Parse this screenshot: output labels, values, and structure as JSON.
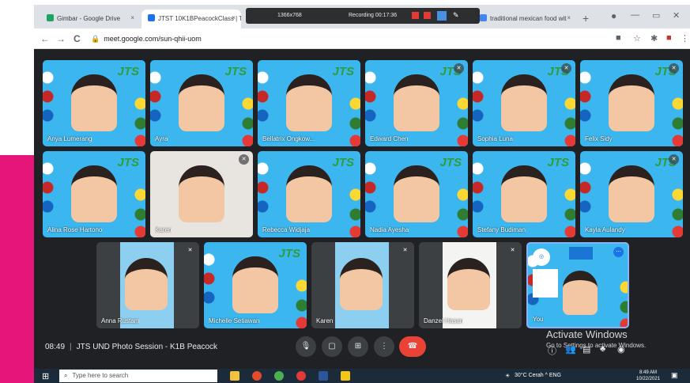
{
  "browser": {
    "tabs": [
      {
        "label": "Gimbar - Google Drive",
        "icon": "drive-icon",
        "color": "#1ea362"
      },
      {
        "label": "JTST 10K1BPeacockClass | To...",
        "icon": "meet-icon",
        "color": "#1a73e8"
      },
      {
        "label": "traditional mexican food wit",
        "icon": "google-icon",
        "color": "#4285f4"
      }
    ],
    "close_glyph": "×",
    "new_tab": "+",
    "url": "meet.google.com/sun-qhii-uom",
    "lock": "🔒",
    "recorder": {
      "label1": "1366x768",
      "label2": "Recording 00:17:36"
    },
    "win_controls": [
      "—",
      "▭",
      "✕"
    ]
  },
  "nav": {
    "back": "←",
    "forward": "→",
    "reload": "C"
  },
  "participants_row1": [
    {
      "name": "Anya Lumerang"
    },
    {
      "name": "Ayra"
    },
    {
      "name": "Bellatrix Ongkow..."
    },
    {
      "name": "Edward Chen"
    },
    {
      "name": "Sophia Luna"
    },
    {
      "name": "Felix Sidy"
    }
  ],
  "participants_row2": [
    {
      "name": "Alina Rose Hartono"
    },
    {
      "name": "Karen"
    },
    {
      "name": "Rebecca Widjaja"
    },
    {
      "name": "Nadia Ayesha"
    },
    {
      "name": "Stefany Budiman"
    },
    {
      "name": "Kayla Aulandy"
    }
  ],
  "participants_row3": [
    {
      "name": "Anna Rustam"
    },
    {
      "name": "Michelle Setiawan"
    },
    {
      "name": "Karen"
    },
    {
      "name": "Danzel Hasan"
    },
    {
      "name": "You"
    }
  ],
  "tile_logo": "JTS",
  "meeting": {
    "time": "08:49",
    "separator": "|",
    "title": "JTS UND Photo Session - K1B Peacock"
  },
  "controls": [
    {
      "name": "mic-button",
      "glyph": "🎙"
    },
    {
      "name": "camera-button",
      "glyph": "▢"
    },
    {
      "name": "present-button",
      "glyph": "⊞"
    },
    {
      "name": "more-options-button",
      "glyph": "⋮"
    },
    {
      "name": "end-call-button",
      "glyph": "☎"
    }
  ],
  "watermark": {
    "line1": "Activate Windows",
    "line2": "Go to Settings to activate Windows."
  },
  "taskbar": {
    "search_placeholder": "Type here to search",
    "tray": "30°C Cerah  ^  ENG",
    "time": "8:49 AM",
    "date": "10/22/2021"
  },
  "colors": {
    "meet_bg": "#202124",
    "tile_blue": "#3bb6ee",
    "end_call": "#ea4335",
    "pink_border": "#e6157a"
  }
}
